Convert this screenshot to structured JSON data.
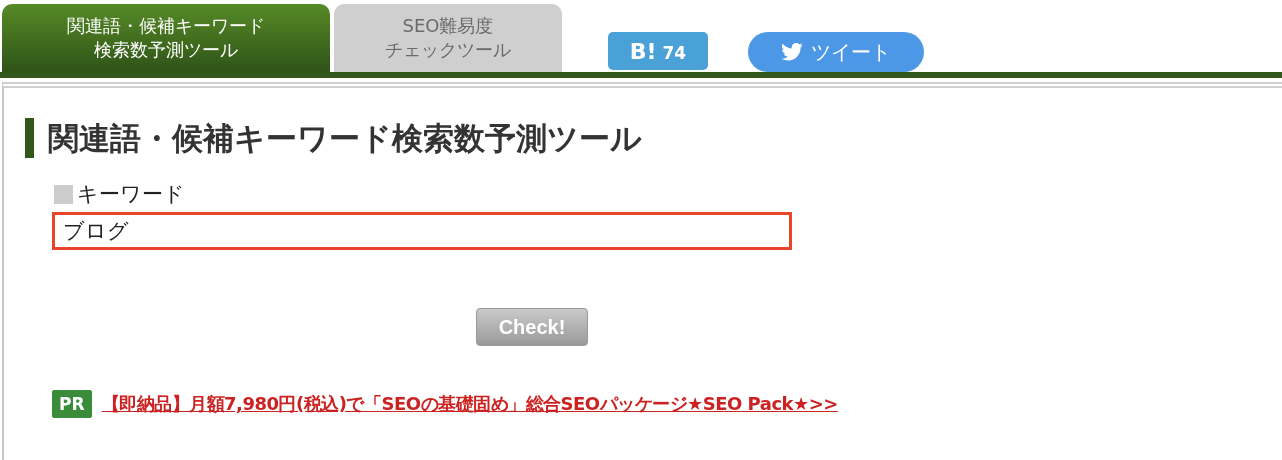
{
  "tabs": [
    {
      "lines": [
        "関連語・候補キーワード",
        "検索数予測ツール"
      ],
      "selected": true
    },
    {
      "lines": [
        "SEO難易度",
        "チェックツール"
      ],
      "selected": false
    }
  ],
  "share": {
    "hatena_label": "B!",
    "hatena_count": "74",
    "tweet_label": "ツイート"
  },
  "heading": "関連語・候補キーワード検索数予測ツール",
  "keyword": {
    "label": "キーワード",
    "value": "ブログ"
  },
  "check_button": "Check!",
  "ad": {
    "badge": "PR",
    "link": "【即納品】月額7,980円(税込)で「SEOの基礎固め」総合SEOパッケージ★SEO Pack★>>"
  }
}
